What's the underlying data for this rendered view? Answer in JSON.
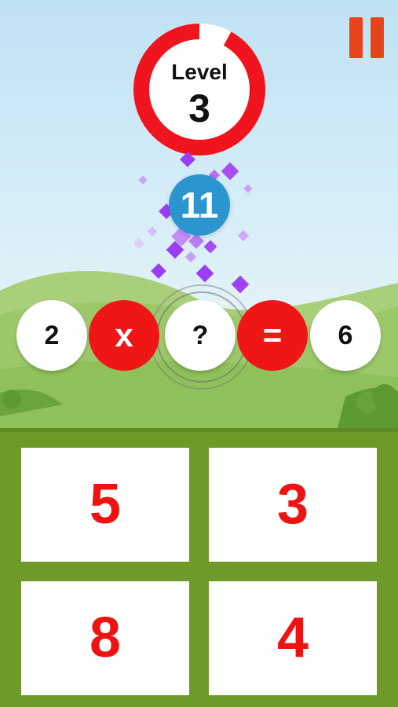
{
  "level": {
    "label": "Level",
    "number": "3",
    "progress": 0.92,
    "ring_color": "#f0141e"
  },
  "score": "11",
  "equation": {
    "operand1": "2",
    "operator": "x",
    "unknown": "?",
    "equals": "=",
    "result": "6"
  },
  "answers": [
    "5",
    "3",
    "8",
    "4"
  ],
  "colors": {
    "accent_red": "#f01616",
    "pause": "#e8441a",
    "score_bubble": "#2a95cf",
    "ground": "#6f9a2a"
  }
}
